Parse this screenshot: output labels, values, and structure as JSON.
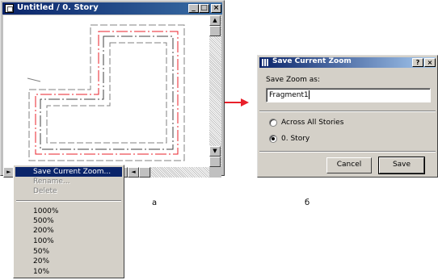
{
  "window": {
    "title": "Untitled / 0. Story",
    "buttons": {
      "minimize": "_",
      "maximize": "□",
      "close": "×"
    }
  },
  "context_menu": {
    "items": [
      {
        "label": "Save Current Zoom...",
        "state": "selected"
      },
      {
        "label": "Rename...",
        "state": "disabled"
      },
      {
        "label": "Delete",
        "state": "disabled"
      }
    ],
    "zoom_levels": [
      "1000%",
      "500%",
      "200%",
      "100%",
      "50%",
      "20%",
      "10%"
    ]
  },
  "captions": {
    "left": "a",
    "right": "б"
  },
  "dialog": {
    "title": "Save Current Zoom",
    "help_button": "?",
    "close_button": "×",
    "prompt": "Save Zoom as:",
    "input_value": "Fragment1",
    "options": [
      {
        "label": "Across All Stories",
        "selected": false
      },
      {
        "label": "0. Story",
        "selected": true
      }
    ],
    "cancel_label": "Cancel",
    "save_label": "Save"
  },
  "colors": {
    "titlebar": "#0a246a",
    "plan_red": "#e8202a",
    "arrow": "#e8202a"
  }
}
